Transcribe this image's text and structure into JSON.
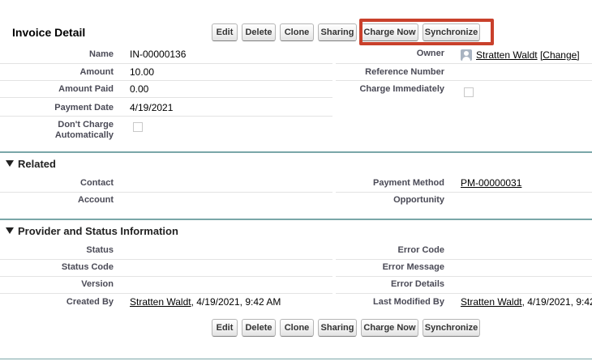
{
  "header": {
    "title": "Invoice Detail"
  },
  "buttons": {
    "edit": "Edit",
    "delete": "Delete",
    "clone": "Clone",
    "sharing": "Sharing",
    "charge_now": "Charge Now",
    "synchronize": "Synchronize"
  },
  "detail": {
    "name_label": "Name",
    "name_value": "IN-00000136",
    "amount_label": "Amount",
    "amount_value": "10.00",
    "amount_paid_label": "Amount Paid",
    "amount_paid_value": "0.00",
    "payment_date_label": "Payment Date",
    "payment_date_value": "4/19/2021",
    "dont_charge_label_1": "Don't Charge",
    "dont_charge_label_2": "Automatically",
    "owner_label": "Owner",
    "owner_value": "Stratten Waldt",
    "owner_change": "[Change]",
    "reference_label": "Reference Number",
    "charge_immediately_label": "Charge Immediately"
  },
  "related": {
    "title": "Related",
    "contact_label": "Contact",
    "account_label": "Account",
    "payment_method_label": "Payment Method",
    "payment_method_value": "PM-00000031",
    "opportunity_label": "Opportunity"
  },
  "provider": {
    "title": "Provider and Status Information",
    "status_label": "Status",
    "status_code_label": "Status Code",
    "version_label": "Version",
    "created_by_label": "Created By",
    "created_by_user": "Stratten Waldt",
    "created_by_date": ", 4/19/2021, 9:42 AM",
    "error_code_label": "Error Code",
    "error_message_label": "Error Message",
    "error_details_label": "Error Details",
    "last_modified_label": "Last Modified By",
    "last_modified_user": "Stratten Waldt",
    "last_modified_date": ", 4/19/2021, 9:42"
  },
  "colors": {
    "highlight_border": "#c9402b",
    "section_rule": "#7aa7a8"
  }
}
